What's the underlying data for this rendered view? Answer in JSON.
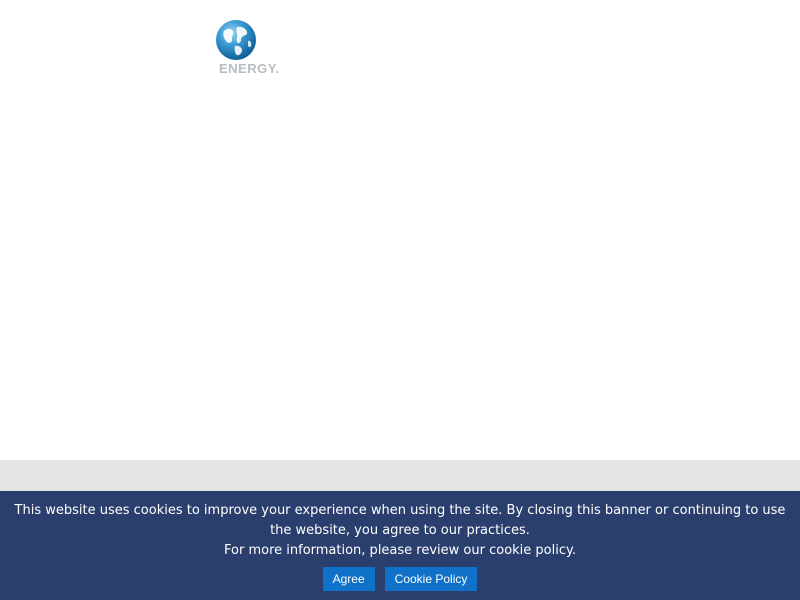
{
  "header": {
    "logo": {
      "icon": "globe-icon",
      "text": "ENERGY."
    }
  },
  "cookie_banner": {
    "message": "This website uses cookies to improve your experience when using the site. By closing this banner or continuing to use the website, you agree to our practices.",
    "more_info": "For more information, please review our cookie policy.",
    "agree_label": "Agree",
    "policy_label": "Cookie Policy"
  },
  "colors": {
    "banner_background": "#2b3f6e",
    "button_background": "#0f72c8",
    "gray_band": "#e4e4e4",
    "logo_text": "#b7bcc0"
  }
}
